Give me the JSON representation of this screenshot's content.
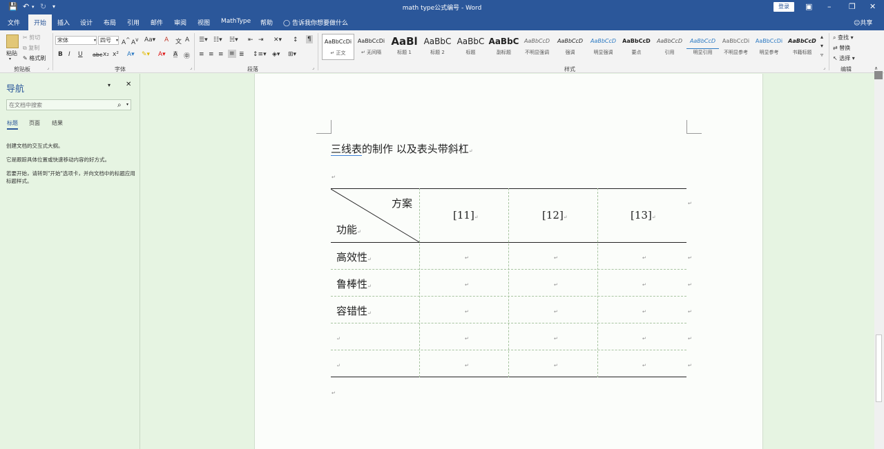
{
  "titlebar": {
    "save_icon": "save-icon",
    "undo_icon": "undo-icon",
    "redo_icon": "redo-icon",
    "title": "math type公式编号  -  Word",
    "login": "登录",
    "ribbon_display_icon": "ribbon-display-icon",
    "minimize_icon": "minimize-icon",
    "restore_icon": "restore-icon",
    "close_icon": "close-icon"
  },
  "tabs": [
    "文件",
    "开始",
    "插入",
    "设计",
    "布局",
    "引用",
    "邮件",
    "审阅",
    "视图",
    "MathType",
    "帮助"
  ],
  "active_tab": "开始",
  "tellme": "告诉我你想要做什么",
  "share": "共享",
  "ribbon": {
    "clipboard": {
      "paste": "粘贴",
      "cut": "剪切",
      "copy": "复制",
      "format_painter": "格式刷",
      "label": "剪贴板"
    },
    "font": {
      "name": "宋体",
      "size": "四号",
      "bold": "B",
      "italic": "I",
      "underline": "U",
      "strike": "abc",
      "sub": "x₂",
      "sup": "x²",
      "label": "字体"
    },
    "paragraph": {
      "label": "段落"
    },
    "styles": {
      "label": "样式",
      "items": [
        {
          "sample": "AaBbCcDi",
          "name": "↵ 正文"
        },
        {
          "sample": "AaBbCcDi",
          "name": "↵ 无间隔"
        },
        {
          "sample": "AaBl",
          "name": "标题 1"
        },
        {
          "sample": "AaBbC",
          "name": "标题 2"
        },
        {
          "sample": "AaBbC",
          "name": "标题"
        },
        {
          "sample": "AaBbC",
          "name": "副标题"
        },
        {
          "sample": "AaBbCcD",
          "name": "不明显强调"
        },
        {
          "sample": "AaBbCcD",
          "name": "强调"
        },
        {
          "sample": "AaBbCcD",
          "name": "明显强调"
        },
        {
          "sample": "AaBbCcD",
          "name": "要点"
        },
        {
          "sample": "AaBbCcD",
          "name": "引用"
        },
        {
          "sample": "AaBbCcD",
          "name": "明显引用"
        },
        {
          "sample": "AaBbCcDi",
          "name": "不明显参考"
        },
        {
          "sample": "AaBbCcDi",
          "name": "明显参考"
        },
        {
          "sample": "AaBbCcD",
          "name": "书籍标题"
        }
      ]
    },
    "editing": {
      "find": "查找",
      "replace": "替换",
      "select": "选择",
      "label": "编辑"
    }
  },
  "nav": {
    "title": "导航",
    "search_placeholder": "在文档中搜索",
    "tabs": [
      "标题",
      "页面",
      "结果"
    ],
    "text1": "创建文档的交互式大纲。",
    "text2": "它是跟踪具体位置或快速移动内容的好方式。",
    "text3": "若要开始，请转到\"开始\"选项卡，并向文档中的标题应用标题样式。"
  },
  "document": {
    "heading_underlined": "三线表",
    "heading_rest": "的制作  以及表头带斜杠",
    "table": {
      "diag_top": "方案",
      "diag_bottom": "功能",
      "col_headers": [
        "[11]",
        "[12]",
        "[13]"
      ],
      "row_labels": [
        "高效性",
        "鲁棒性",
        "容错性",
        "",
        ""
      ]
    }
  },
  "colors": {
    "accent": "#2b579a",
    "page_bg": "#fbfdfa",
    "eye_care_green": "#e6f4e2"
  }
}
